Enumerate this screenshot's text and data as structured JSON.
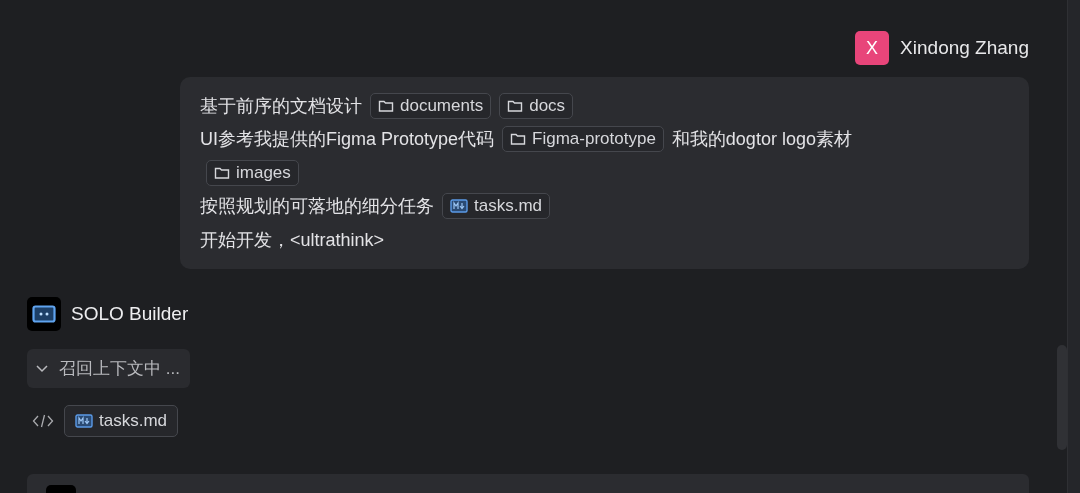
{
  "user": {
    "avatar": "X",
    "name": "Xindong Zhang"
  },
  "message": {
    "lines": [
      [
        {
          "kind": "text",
          "text": "基于前序的文档设计"
        },
        {
          "kind": "folder",
          "text": "documents"
        },
        {
          "kind": "folder",
          "text": "docs"
        }
      ],
      [
        {
          "kind": "text",
          "text": "UI参考我提供的Figma Prototype代码"
        },
        {
          "kind": "folder",
          "text": "Figma-prototype"
        },
        {
          "kind": "text",
          "text": "和我的dogtor logo素材"
        }
      ],
      [
        {
          "kind": "folder",
          "text": "images"
        }
      ],
      [
        {
          "kind": "text",
          "text": "按照规划的可落地的细分任务"
        },
        {
          "kind": "file",
          "text": "tasks.md"
        }
      ],
      [
        {
          "kind": "text",
          "text": "开始开发，<ultrathink>"
        }
      ]
    ]
  },
  "agent": {
    "name": "SOLO Builder"
  },
  "steps": [
    {
      "kind": "collapsible",
      "text": "召回上下文中 ...",
      "expanded": true
    },
    {
      "kind": "code",
      "file": "tasks.md"
    }
  ]
}
